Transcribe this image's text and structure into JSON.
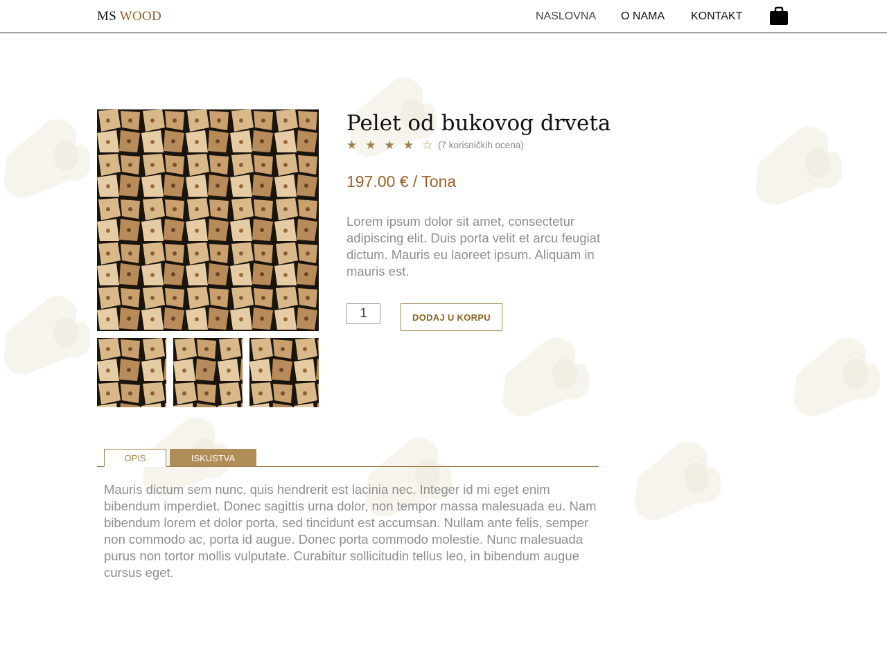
{
  "header": {
    "logo_ms": "MS",
    "logo_wood": "WOOD",
    "nav": [
      "NASLOVNA",
      "O NAMA",
      "KONTAKT"
    ],
    "cart_icon": "shopping-bag-icon"
  },
  "product": {
    "title": "Pelet od bukovog drveta",
    "rating": 4,
    "rating_max": 5,
    "stars": "★★★★☆",
    "rating_text": "(7 korisničkih ocena)",
    "price": "197.00 € / Tona",
    "description": "Lorem ipsum dolor sit amet, consectetur adipiscing elit. Duis porta velit et arcu feugiat dictum. Mauris eu laoreet ipsum. Aliquam in mauris est.",
    "quantity": "1",
    "add_to_cart": "DODAJ U KORPU"
  },
  "tabs": {
    "items": [
      "OPIS",
      "ISKUSTVA"
    ],
    "content": "Mauris dictum sem nunc, quis hendrerit est lacinia nec. Integer id mi eget enim bibendum imperdiet. Donec sagittis urna dolor, non tempor massa malesuada eu. Nam bibendum lorem et dolor porta, sed tincidunt est accumsan. Nullam ante felis, semper non commodo ac, porta id augue. Donec porta commodo molestie. Nunc malesuada purus non tortor mollis vulputate. Curabitur sollicitudin tellus leo, in bibendum augue cursus eget."
  },
  "colors": {
    "accent": "#a07f4b",
    "price": "#96632d",
    "muted_text": "#8e8e8e",
    "log_bg": "#f6f3ec"
  }
}
